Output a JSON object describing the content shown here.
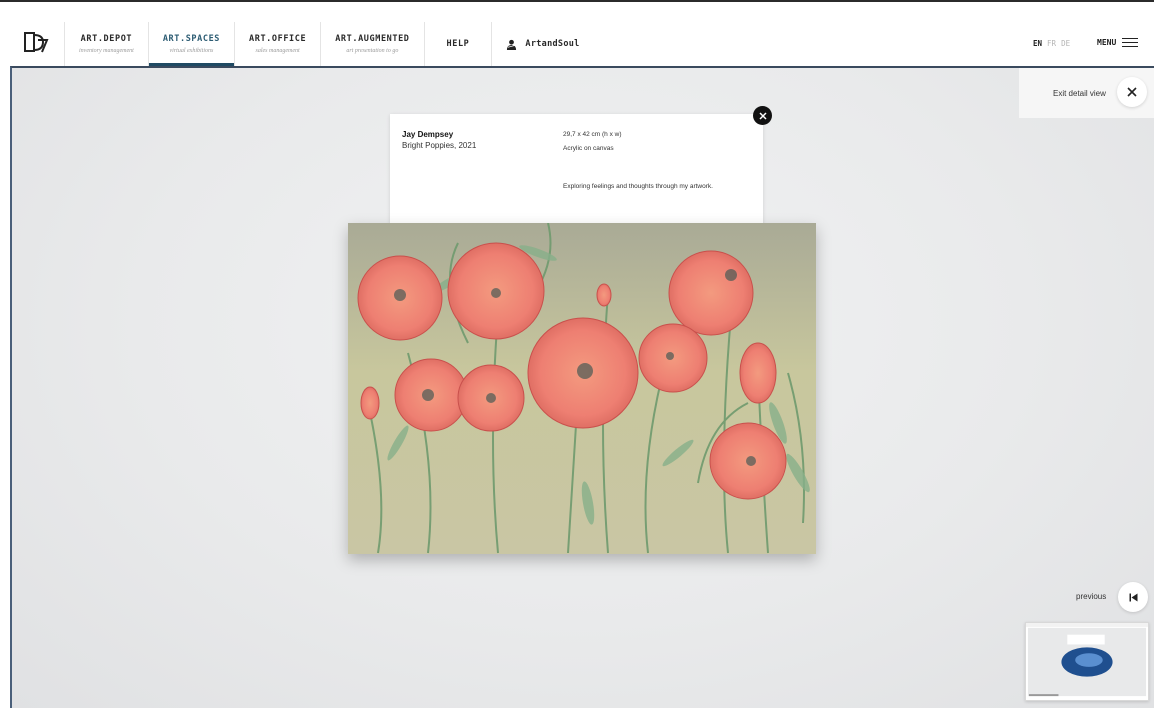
{
  "nav": {
    "items": [
      {
        "label": "ART.DEPOT",
        "sub": "inventory management"
      },
      {
        "label": "ART.SPACES",
        "sub": "virtual exhibitions"
      },
      {
        "label": "ART.OFFICE",
        "sub": "sales management"
      },
      {
        "label": "ART.AUGMENTED",
        "sub": "art presentation to go"
      },
      {
        "label": "HELP",
        "sub": ""
      }
    ],
    "brand": "ArtandSoul"
  },
  "lang": {
    "en": "EN",
    "fr": "FR",
    "de": "DE"
  },
  "menu": {
    "label": "MENU"
  },
  "exit": {
    "label": "Exit detail view"
  },
  "artwork": {
    "artist": "Jay Dempsey",
    "title": "Bright Poppies, 2021",
    "dimensions": "29,7 x 42 cm (h x w)",
    "medium": "Acrylic on canvas",
    "description": "Exploring feelings and thoughts through my artwork."
  },
  "previous": {
    "label": "previous"
  },
  "icons": {
    "logo": "artmoi-logo-icon",
    "brand": "user-bust-icon",
    "menu": "hamburger-icon",
    "exit": "close-icon",
    "card_close": "close-circle-icon",
    "previous": "skip-previous-icon"
  },
  "colors": {
    "accent": "#1f4a63",
    "active_label": "#2c5c73",
    "viewport_border": "#4a5f7a"
  }
}
